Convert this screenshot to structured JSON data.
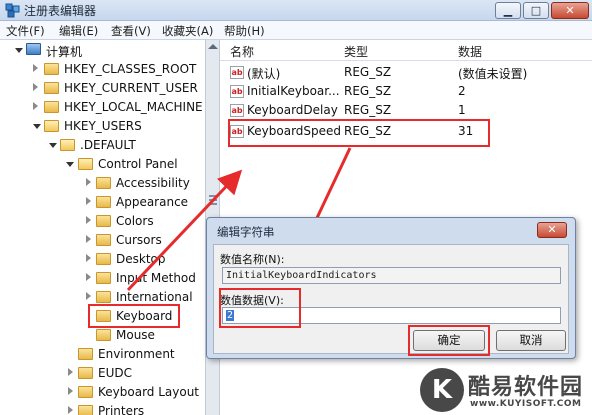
{
  "window": {
    "title": "注册表编辑器",
    "min_glyph": "▁",
    "max_glyph": "□",
    "close_glyph": "✕"
  },
  "menu": [
    "文件(F)",
    "编辑(E)",
    "查看(V)",
    "收藏夹(A)",
    "帮助(H)"
  ],
  "tree": [
    {
      "label": "计算机",
      "expanded": true
    },
    {
      "label": "HKEY_CLASSES_ROOT",
      "expanded": false
    },
    {
      "label": "HKEY_CURRENT_USER",
      "expanded": false
    },
    {
      "label": "HKEY_LOCAL_MACHINE",
      "expanded": false
    },
    {
      "label": "HKEY_USERS",
      "expanded": true
    },
    {
      "label": ".DEFAULT",
      "expanded": true
    },
    {
      "label": "Control Panel",
      "expanded": true
    },
    {
      "label": "Accessibility",
      "expanded": false
    },
    {
      "label": "Appearance",
      "expanded": false
    },
    {
      "label": "Colors",
      "expanded": false
    },
    {
      "label": "Cursors",
      "expanded": false
    },
    {
      "label": "Desktop",
      "expanded": false
    },
    {
      "label": "Input Method",
      "expanded": false
    },
    {
      "label": "International",
      "expanded": false
    },
    {
      "label": "Keyboard",
      "selected": true
    },
    {
      "label": "Mouse"
    },
    {
      "label": "Environment"
    },
    {
      "label": "EUDC",
      "expanded": false
    },
    {
      "label": "Keyboard Layout",
      "expanded": false
    },
    {
      "label": "Printers",
      "expanded": false
    }
  ],
  "list": {
    "columns": [
      "名称",
      "类型",
      "数据"
    ],
    "rows": [
      {
        "icon": "ab",
        "name": "(默认)",
        "type": "REG_SZ",
        "data": "(数值未设置)"
      },
      {
        "icon": "ab",
        "name": "InitialKeyboar...",
        "type": "REG_SZ",
        "data": "2"
      },
      {
        "icon": "ab",
        "name": "KeyboardDelay",
        "type": "REG_SZ",
        "data": "1"
      },
      {
        "icon": "ab",
        "name": "KeyboardSpeed",
        "type": "REG_SZ",
        "data": "31"
      }
    ]
  },
  "dialog": {
    "title": "编辑字符串",
    "close_glyph": "✕",
    "name_label": "数值名称(N):",
    "name_value": "InitialKeyboardIndicators",
    "data_label": "数值数据(V):",
    "data_value": "2",
    "ok_label": "确定",
    "cancel_label": "取消"
  },
  "watermark": {
    "logo_letter": "K",
    "text": "酷易软件园",
    "url": "www.KUYISOFT.COM"
  },
  "colors": {
    "highlight": "#e52b2b",
    "selection": "#3a78d4"
  }
}
